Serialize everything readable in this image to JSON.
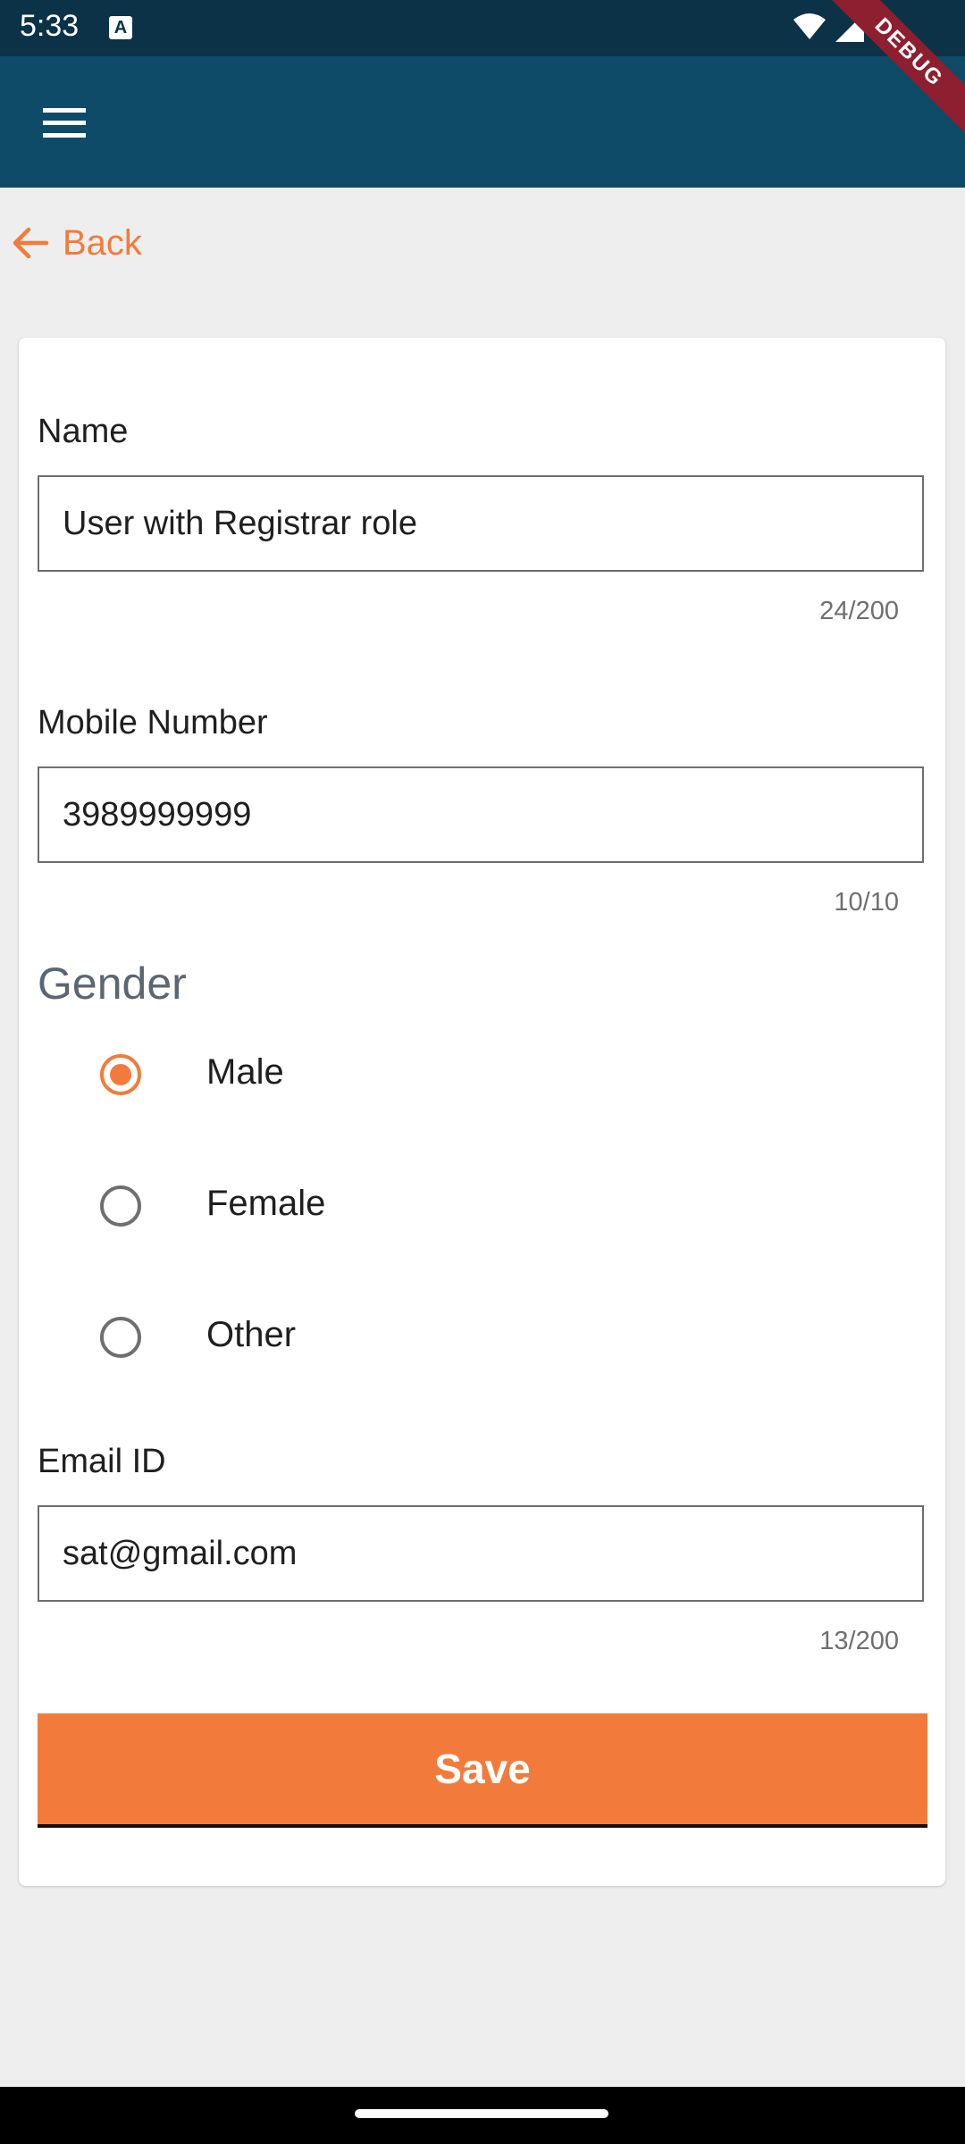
{
  "status_bar": {
    "time": "5:33",
    "notification_glyph": "A",
    "icons": [
      "wifi-icon",
      "cell-signal-icon"
    ],
    "debug_banner": "DEBUG"
  },
  "app_bar": {
    "menu_icon": "hamburger-menu-icon",
    "color": "#0e4b69"
  },
  "back": {
    "label": "Back",
    "icon": "arrow-left-icon"
  },
  "form": {
    "name": {
      "label": "Name",
      "value": "User with Registrar role",
      "counter": "24/200"
    },
    "mobile": {
      "label": "Mobile Number",
      "value": "3989999999",
      "counter": "10/10"
    },
    "gender": {
      "heading": "Gender",
      "options": [
        {
          "label": "Male",
          "selected": true
        },
        {
          "label": "Female",
          "selected": false
        },
        {
          "label": "Other",
          "selected": false
        }
      ]
    },
    "email": {
      "label": "Email ID",
      "value": "sat@gmail.com",
      "counter": "13/200"
    },
    "save_label": "Save"
  },
  "colors": {
    "accent": "#f27b3b",
    "status_bar": "#0b3247",
    "background": "#eeeeee"
  }
}
